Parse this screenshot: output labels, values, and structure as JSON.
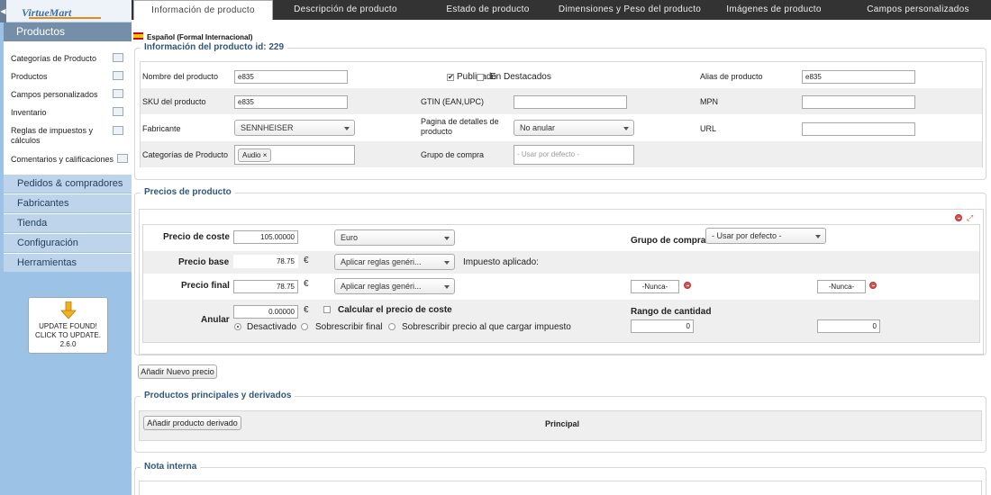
{
  "brand": {
    "logo_text": "VirtueMart"
  },
  "sidebar": {
    "section_title": "Productos",
    "sub_items": [
      {
        "label": "Categorías de Producto",
        "icon": "category-icon"
      },
      {
        "label": "Productos",
        "icon": "products-icon"
      },
      {
        "label": "Campos personalizados",
        "icon": "custom-fields-icon"
      },
      {
        "label": "Inventario",
        "icon": "inventory-icon"
      },
      {
        "label": "Reglas de impuestos y cálculos",
        "icon": "tax-rules-icon"
      },
      {
        "label": "Comentarios y calificaciones",
        "icon": "reviews-icon"
      }
    ],
    "accordion": [
      "Pedidos & compradores",
      "Fabricantes",
      "Tienda",
      "Configuración",
      "Herramientas"
    ],
    "update": {
      "line1": "UPDATE FOUND!",
      "line2": "CLICK TO UPDATE.",
      "version": "2.6.0"
    }
  },
  "tabs": [
    {
      "label": "Información de producto",
      "active": true
    },
    {
      "label": "Descripción de producto",
      "active": false
    },
    {
      "label": "Estado de producto",
      "active": false
    },
    {
      "label": "Dimensiones y Peso del producto",
      "active": false
    },
    {
      "label": "Imágenes de producto",
      "active": false
    },
    {
      "label": "Campos personalizados",
      "active": false
    }
  ],
  "language": {
    "label": "Español (Formal Internacional)",
    "flag": "spain-flag-icon"
  },
  "info": {
    "legend": "Información del producto id: 229",
    "nombre_label": "Nombre del producto",
    "nombre_value": "e835",
    "publicado_label": "Publicado",
    "publicado_checked": true,
    "destacados_label": "En Destacados",
    "destacados_checked": false,
    "alias_label": "Alias de producto",
    "alias_value": "e835",
    "sku_label": "SKU del producto",
    "sku_value": "e835",
    "gtin_label": "GTIN (EAN,UPC)",
    "gtin_value": "",
    "mpn_label": "MPN",
    "mpn_value": "",
    "fabricante_label": "Fabricante",
    "fabricante_value": "SENNHEISER",
    "pagina_label": "Pagina de detalles de producto",
    "pagina_value": "No anular",
    "url_label": "URL",
    "url_value": "",
    "categorias_label": "Categorías de Producto",
    "categoria_tag": "Audio",
    "grupo_label": "Grupo de compra",
    "grupo_placeholder": "- Usar por defecto -"
  },
  "prices": {
    "legend": "Precios de producto",
    "coste_label": "Precio de coste",
    "coste_value": "105.00000",
    "currency": "Euro",
    "grupo_label": "Grupo de compra",
    "grupo_value": "- Usar por defecto -",
    "base_label": "Precio base",
    "base_value": "78.75",
    "euro": "€",
    "base_rule": "Aplicar reglas genéri...",
    "impuesto_label": "Impuesto aplicado:",
    "final_label": "Precio final",
    "final_value": "78.75",
    "final_rule": "Aplicar reglas genéri...",
    "nunca1": "-Nunca-",
    "nunca2": "-Nunca-",
    "anular_label": "Anular",
    "anular_value": "0.00000",
    "calcular_label": "Calcular el precio de coste",
    "rango_label": "Rango de cantidad",
    "rango_from": "0",
    "rango_to": "0",
    "radio_desactivado": "Desactivado",
    "radio_sobrescribir": "Sobrescribir final",
    "radio_sobrescribir_impuesto": "Sobrescribir precio al que cargar impuesto",
    "add_button": "Añadir Nuevo precio"
  },
  "derived": {
    "legend": "Productos principales y derivados",
    "add_button": "Añadir producto derivado",
    "principal_label": "Principal"
  },
  "notes": {
    "legend": "Nota interna"
  }
}
